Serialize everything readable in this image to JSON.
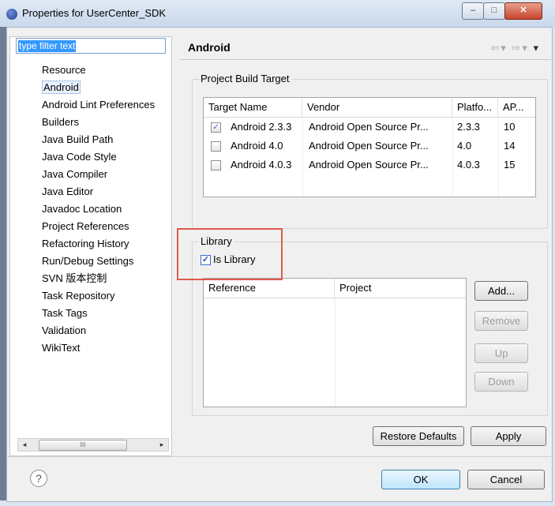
{
  "window": {
    "title": "Properties for UserCenter_SDK",
    "controls": {
      "minimize": "–",
      "maximize": "□",
      "close": "✕"
    }
  },
  "filter": {
    "placeholder": "type filter text"
  },
  "tree": {
    "items": [
      "Resource",
      "Android",
      "Android Lint Preferences",
      "Builders",
      "Java Build Path",
      "Java Code Style",
      "Java Compiler",
      "Java Editor",
      "Javadoc Location",
      "Project References",
      "Refactoring History",
      "Run/Debug Settings",
      "SVN 版本控制",
      "Task Repository",
      "Task Tags",
      "Validation",
      "WikiText"
    ],
    "selected": "Android",
    "scroll_thumb": "III"
  },
  "page": {
    "title": "Android",
    "nav": {
      "back": "⇦",
      "back_menu": "▾",
      "forward": "⇨",
      "forward_menu": "▾",
      "view_menu": "▾"
    }
  },
  "build_target": {
    "label": "Project Build Target",
    "columns": [
      "Target Name",
      "Vendor",
      "Platfo...",
      "AP..."
    ],
    "rows": [
      {
        "checked": true,
        "name": "Android 2.3.3",
        "vendor": "Android Open Source Pr...",
        "platform": "2.3.3",
        "api": "10"
      },
      {
        "checked": false,
        "name": "Android 4.0",
        "vendor": "Android Open Source Pr...",
        "platform": "4.0",
        "api": "14"
      },
      {
        "checked": false,
        "name": "Android 4.0.3",
        "vendor": "Android Open Source Pr...",
        "platform": "4.0.3",
        "api": "15"
      }
    ]
  },
  "library": {
    "label": "Library",
    "is_library_label": "Is Library",
    "is_library_checked": true,
    "columns": [
      "Reference",
      "Project"
    ],
    "buttons": {
      "add": "Add...",
      "remove": "Remove",
      "up": "Up",
      "down": "Down"
    }
  },
  "actions": {
    "restore_defaults": "Restore Defaults",
    "apply": "Apply",
    "ok": "OK",
    "cancel": "Cancel",
    "help": "?"
  },
  "check_mark": "✓"
}
